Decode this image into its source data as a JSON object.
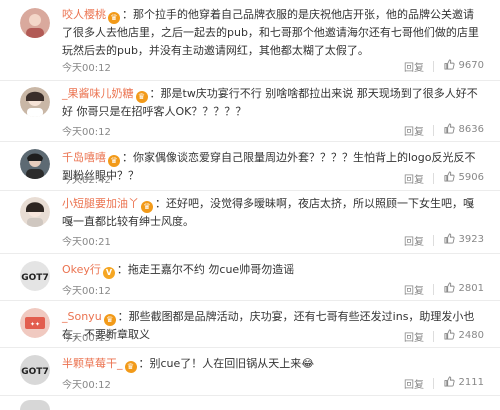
{
  "comments": [
    {
      "username": "咬人樱桃",
      "badge": "vip",
      "text": "：那个拉手的他穿着自己品牌衣服的是庆祝他店开张，他的品牌公关邀请了很多人去他店里，之后一起去的pub，和七哥那个他邀请海尔还有七哥他们做的店里玩然后去的pub，并没有主动邀请网红，其他都太糊了太假了。",
      "time": "今天00:12",
      "reply": "回复",
      "likes": "9670"
    },
    {
      "username": "_果酱味儿奶糖",
      "badge": "vip",
      "text": "：那是tw庆功宴行不行 别啥啥都拉出来说 那天现场到了很多人好不好 你哥只是在招呼客人OK？？？？？",
      "time": "今天00:12",
      "reply": "回复",
      "likes": "8636"
    },
    {
      "username": "千岛嘻嘻",
      "badge": "vip",
      "text": "：你家偶像谈恋爱穿自己限量周边外套？？？？生怕背上的logo反光反不到粉丝眼中？？",
      "time": "今天02:42",
      "reply": "回复",
      "likes": "5906"
    },
    {
      "username": "小短腿要加油丫",
      "badge": "vip",
      "text": "：还好吧，没觉得多暧昧啊，夜店太挤，所以照顾一下女生吧，嘎嘎一直都比较有绅士风度。",
      "time": "今天00:21",
      "reply": "回复",
      "likes": "3923"
    },
    {
      "username": "Okey行",
      "badge": "v",
      "text": "：拖走王嘉尔不约 勿cue帅哥勿造谣",
      "time": "今天00:12",
      "reply": "回复",
      "likes": "2801"
    },
    {
      "username": "_Sonyu",
      "badge": "vip",
      "text": "：那些截图都是品牌活动，庆功宴，还有七哥有些还发过ins，助理发小也在，不要断章取义",
      "time": "今天00:15",
      "reply": "回复",
      "likes": "2480"
    },
    {
      "username": "半颗草莓干_",
      "badge": "vip",
      "text": "：别cue了！人在回旧锅从天上来😂",
      "time": "今天00:12",
      "reply": "回复",
      "likes": "2111"
    }
  ],
  "colors": {
    "username": "#eb7350",
    "text": "#333333",
    "meta": "#888888"
  }
}
